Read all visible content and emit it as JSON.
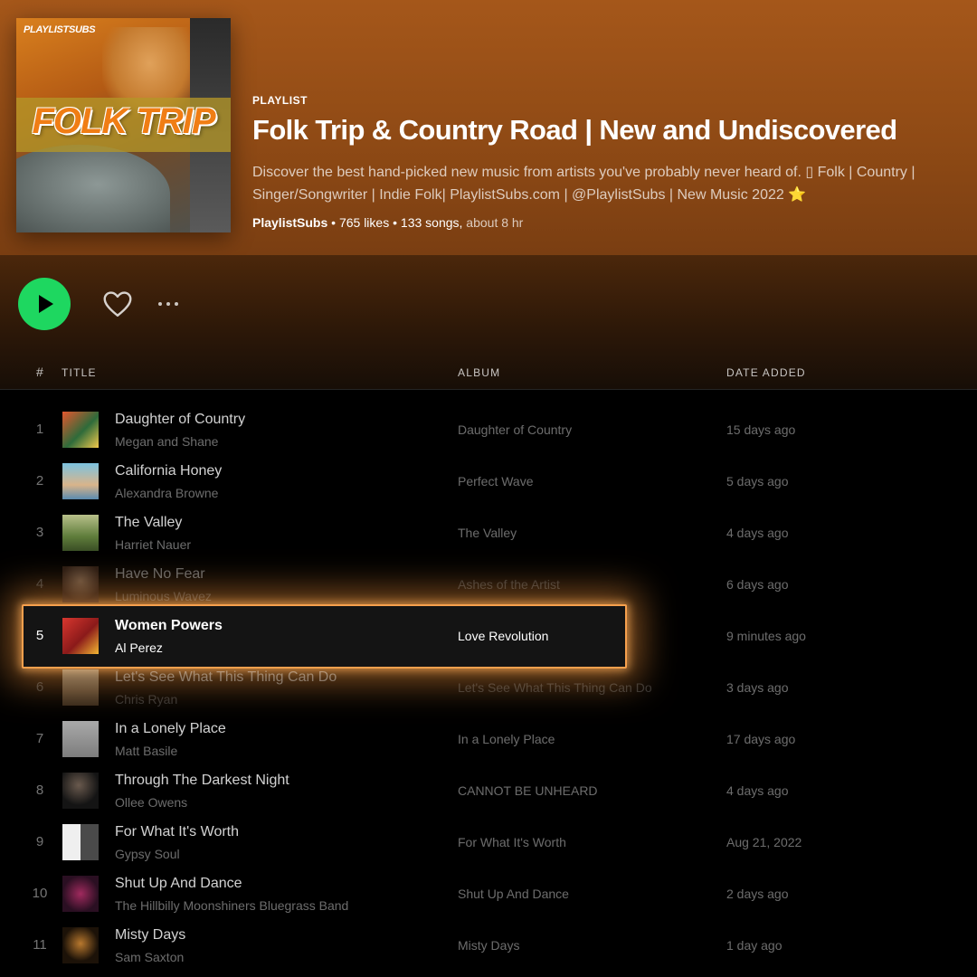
{
  "playlist": {
    "cover_brand": "PLAYLISTSUBS",
    "cover_title": "FOLK TRIP",
    "type_label": "PLAYLIST",
    "title": "Folk Trip & Country Road | New and Undiscovered",
    "description_line1": "Discover the best hand-picked new music from artists you've probably never heard of. ▯ Folk | Country |",
    "description_line2": "Singer/Songwriter | Indie Folk| PlaylistSubs.com | @PlaylistSubs | New Music 2022",
    "description_star": "⭐",
    "owner": "PlaylistSubs",
    "likes": "765 likes",
    "songs": "133 songs,",
    "duration": "about 8 hr",
    "separator": "•"
  },
  "columns": {
    "number": "#",
    "title": "TITLE",
    "album": "ALBUM",
    "date_added": "DATE ADDED"
  },
  "tracks": [
    {
      "number": "1",
      "title": "Daughter of Country",
      "artist": "Megan and Shane",
      "album": "Daughter of Country",
      "date_added": "15 days ago",
      "art_color": "#c0462a"
    },
    {
      "number": "2",
      "title": "California Honey",
      "artist": "Alexandra Browne",
      "album": "Perfect Wave",
      "date_added": "5 days ago",
      "art_color": "#5aa7c9"
    },
    {
      "number": "3",
      "title": "The Valley",
      "artist": "Harriet Nauer",
      "album": "The Valley",
      "date_added": "4 days ago",
      "art_color": "#7a9a4e"
    },
    {
      "number": "4",
      "title": "Have No Fear",
      "artist": "Luminous Wavez",
      "album": "Ashes of the Artist",
      "date_added": "6 days ago",
      "art_color": "#8a6a52"
    },
    {
      "number": "5",
      "title": "Women Powers",
      "artist": "Al Perez",
      "album": "Love Revolution",
      "date_added": "9 minutes ago",
      "art_color": "#c8302c"
    },
    {
      "number": "6",
      "title": "Let's See What This Thing Can Do",
      "artist": "Chris Ryan",
      "album": "Let's See What This Thing Can Do",
      "date_added": "3 days ago",
      "art_color": "#c9b48e"
    },
    {
      "number": "7",
      "title": "In a Lonely Place",
      "artist": "Matt Basile",
      "album": "In a Lonely Place",
      "date_added": "17 days ago",
      "art_color": "#9a9a9a"
    },
    {
      "number": "8",
      "title": "Through The Darkest Night",
      "artist": "Ollee Owens",
      "album": "CANNOT BE UNHEARD",
      "date_added": "4 days ago",
      "art_color": "#2a2a2a"
    },
    {
      "number": "9",
      "title": "For What It's Worth",
      "artist": "Gypsy Soul",
      "album": "For What It's Worth",
      "date_added": "Aug 21, 2022",
      "art_color": "#d8d8d8"
    },
    {
      "number": "10",
      "title": "Shut Up And Dance",
      "artist": "The Hillbilly Moonshiners Bluegrass Band",
      "album": "Shut Up And Dance",
      "date_added": "2 days ago",
      "art_color": "#5a1f3a"
    },
    {
      "number": "11",
      "title": "Misty Days",
      "artist": "Sam Saxton",
      "album": "Misty Days",
      "date_added": "1 day ago",
      "art_color": "#3b2a18"
    }
  ],
  "colors": {
    "header_accent": "#a5571a",
    "play_button": "#1ed760",
    "highlight_glow": "#f6a04d"
  },
  "icons": {
    "play": "play-icon",
    "like": "heart-icon",
    "more": "more-options-icon"
  }
}
